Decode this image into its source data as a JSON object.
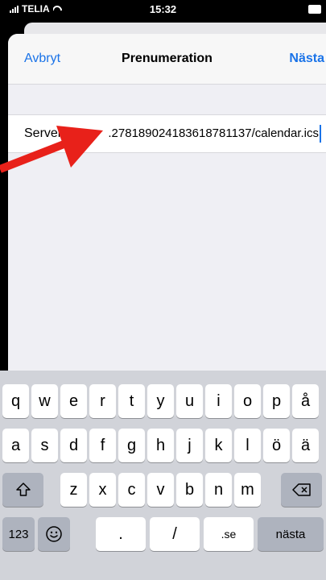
{
  "status_bar": {
    "carrier": "TELIA",
    "time": "15:32"
  },
  "nav": {
    "cancel": "Avbryt",
    "title": "Prenumeration",
    "next": "Nästa"
  },
  "field": {
    "label": "Server",
    "value": ".278189024183618781137/calendar.ics",
    "placeholder": ""
  },
  "keyboard": {
    "row1": [
      "q",
      "w",
      "e",
      "r",
      "t",
      "y",
      "u",
      "i",
      "o",
      "p",
      "å"
    ],
    "row2": [
      "a",
      "s",
      "d",
      "f",
      "g",
      "h",
      "j",
      "k",
      "l",
      "ö",
      "ä"
    ],
    "row3": [
      "z",
      "x",
      "c",
      "v",
      "b",
      "n",
      "m"
    ],
    "numbers_key": "123",
    "dot_key": ".",
    "slash_key": "/",
    "domain_key": ".se",
    "return_key": "nästa",
    "shift_icon": "shift-icon",
    "delete_icon": "delete-icon",
    "emoji_icon": "emoji-icon"
  },
  "annotation": {
    "arrow_color": "#e8211a"
  }
}
